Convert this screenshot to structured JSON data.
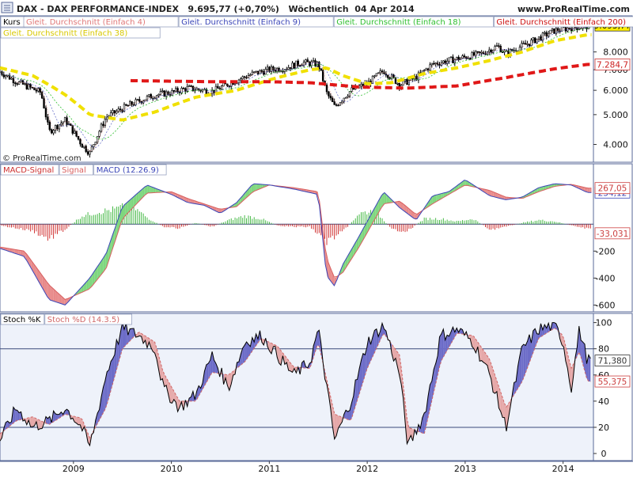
{
  "header": {
    "instrument": "DAX - DAX PERFORMANCE-INDEX",
    "last_change": "9.695,77 (+0,70%)",
    "period": "Wöchentlich",
    "date": "04 Apr 2014",
    "website": "www.ProRealTime.com",
    "watermark": "© ProRealTime.com"
  },
  "colors": {
    "ma4": "#e07878",
    "ma9": "#3b46b8",
    "ma18": "#2fbf2f",
    "ma200": "#e01818",
    "ma38": "#f0e000",
    "macd_line": "#3b46b8",
    "macd_signal": "#d86060",
    "macd_hist_pos": "#34b234",
    "macd_hist_neg": "#cc2020",
    "stoch_k": "#000000",
    "stoch_d": "#d06868",
    "stoch_fill_up": "#6c6cc8",
    "stoch_fill_down": "#e6a8a8",
    "frame": "#5a6a98",
    "panel_bg": "#eef2fa"
  },
  "chart_data": [
    {
      "type": "line",
      "name": "price-panel",
      "legend": {
        "title": "Kurs",
        "items": [
          "Gleit. Durchschnitt (Einfach 4)",
          "Gleit. Durchschnitt (Einfach 9)",
          "Gleit. Durchschnitt (Einfach 18)",
          "Gleit. Durchschnitt (Einfach 200)",
          "Gleit. Durchschnitt (Einfach 38)"
        ]
      },
      "x_labels": [
        "2009",
        "2010",
        "2011",
        "2012",
        "2013",
        "2014"
      ],
      "y_ticks": [
        4000,
        5000,
        6000,
        7000,
        8000
      ],
      "y_tick_labels": [
        "4.000",
        "5.000",
        "6.000",
        "7.000",
        "8.000"
      ],
      "ylim": [
        3500,
        10000
      ],
      "y_log": true,
      "price_path": {
        "x": [
          "2008-04",
          "2008-06",
          "2008-09",
          "2008-10",
          "2008-12",
          "2009-02",
          "2009-03",
          "2009-05",
          "2009-08",
          "2009-11",
          "2010-01",
          "2010-03",
          "2010-06",
          "2010-08",
          "2010-11",
          "2011-01",
          "2011-03",
          "2011-05",
          "2011-07",
          "2011-08",
          "2011-09",
          "2011-11",
          "2012-01",
          "2012-03",
          "2012-05",
          "2012-07",
          "2012-09",
          "2012-12",
          "2013-03",
          "2013-05",
          "2013-06",
          "2013-09",
          "2013-12",
          "2014-02",
          "2014-04"
        ],
        "values": [
          6900,
          6400,
          5900,
          4400,
          4800,
          4000,
          3750,
          4900,
          5400,
          5800,
          5900,
          6100,
          5950,
          6300,
          6800,
          7000,
          7100,
          7400,
          7300,
          5900,
          5300,
          6000,
          6300,
          6950,
          6250,
          6600,
          7300,
          7600,
          7900,
          8350,
          7900,
          8600,
          9400,
          9600,
          9696
        ]
      },
      "ma38_path": {
        "x": [
          "2008-04",
          "2008-08",
          "2008-12",
          "2009-03",
          "2009-07",
          "2009-11",
          "2010-04",
          "2010-09",
          "2011-02",
          "2011-06",
          "2011-08",
          "2011-10",
          "2012-01",
          "2012-04",
          "2012-08",
          "2012-12",
          "2013-04",
          "2013-08",
          "2013-12",
          "2014-04"
        ],
        "values": [
          7100,
          6700,
          5800,
          5000,
          4800,
          5100,
          5700,
          6000,
          6600,
          7000,
          7100,
          6700,
          6300,
          6350,
          6800,
          7100,
          7500,
          8000,
          8700,
          9100
        ]
      },
      "ma200_path": {
        "x": [
          "2009-08",
          "2010-06",
          "2011-01",
          "2011-06",
          "2011-12",
          "2012-06",
          "2012-12",
          "2013-06",
          "2013-12",
          "2014-04"
        ],
        "values": [
          6450,
          6400,
          6400,
          6350,
          6150,
          6100,
          6200,
          6600,
          7050,
          7285
        ]
      },
      "value_labels": [
        "9.695,77",
        "7.284,7"
      ]
    },
    {
      "type": "line",
      "name": "macd-panel",
      "legend": {
        "items": [
          "MACD-Signal",
          "Signal",
          "MACD (12.26.9)"
        ]
      },
      "y_ticks": [
        -600,
        -400,
        -200
      ],
      "y_tick_labels": [
        "-600",
        "-400",
        "-200"
      ],
      "ylim": [
        -650,
        400
      ],
      "series": [
        {
          "name": "MACD (12.26.9)",
          "x": [
            "2008-04",
            "2008-07",
            "2008-10",
            "2008-12",
            "2009-03",
            "2009-05",
            "2009-07",
            "2009-10",
            "2010-01",
            "2010-03",
            "2010-05",
            "2010-07",
            "2010-09",
            "2010-11",
            "2011-01",
            "2011-04",
            "2011-07",
            "2011-08",
            "2011-09",
            "2011-10",
            "2011-12",
            "2012-03",
            "2012-05",
            "2012-07",
            "2012-09",
            "2012-11",
            "2013-01",
            "2013-04",
            "2013-06",
            "2013-08",
            "2013-10",
            "2013-12",
            "2014-02",
            "2014-04"
          ],
          "values": [
            -180,
            -240,
            -560,
            -600,
            -400,
            -220,
            130,
            290,
            220,
            160,
            140,
            80,
            160,
            300,
            290,
            260,
            220,
            -380,
            -460,
            -300,
            -90,
            240,
            120,
            30,
            210,
            240,
            330,
            210,
            180,
            200,
            270,
            300,
            290,
            234
          ]
        },
        {
          "name": "Signal",
          "x": [
            "2008-04",
            "2008-07",
            "2008-10",
            "2008-12",
            "2009-03",
            "2009-05",
            "2009-07",
            "2009-10",
            "2010-01",
            "2010-03",
            "2010-05",
            "2010-07",
            "2010-09",
            "2010-11",
            "2011-01",
            "2011-04",
            "2011-07",
            "2011-08",
            "2011-09",
            "2011-10",
            "2011-12",
            "2012-03",
            "2012-05",
            "2012-07",
            "2012-09",
            "2012-11",
            "2013-01",
            "2013-04",
            "2013-06",
            "2013-08",
            "2013-10",
            "2013-12",
            "2014-02",
            "2014-04"
          ],
          "values": [
            -170,
            -200,
            -450,
            -560,
            -480,
            -330,
            40,
            230,
            240,
            190,
            150,
            110,
            130,
            240,
            290,
            270,
            240,
            -250,
            -400,
            -360,
            -170,
            150,
            170,
            70,
            150,
            220,
            290,
            250,
            200,
            190,
            240,
            280,
            295,
            267
          ]
        },
        {
          "name": "MACD-Signal",
          "x": [
            "2008-04",
            "2008-06",
            "2008-08",
            "2008-10",
            "2008-12",
            "2009-02",
            "2009-04",
            "2009-06",
            "2009-08",
            "2009-10",
            "2009-12",
            "2010-02",
            "2010-04",
            "2010-06",
            "2010-08",
            "2010-10",
            "2010-12",
            "2011-02",
            "2011-04",
            "2011-06",
            "2011-08",
            "2011-10",
            "2011-12",
            "2012-02",
            "2012-04",
            "2012-06",
            "2012-08",
            "2012-10",
            "2012-12",
            "2013-02",
            "2013-04",
            "2013-06",
            "2013-08",
            "2013-10",
            "2013-12",
            "2014-02",
            "2014-04"
          ],
          "values": [
            -10,
            -30,
            -50,
            -110,
            -40,
            60,
            90,
            110,
            140,
            50,
            -20,
            -30,
            10,
            -20,
            30,
            60,
            40,
            -10,
            -20,
            -20,
            -130,
            -60,
            80,
            100,
            -40,
            -50,
            40,
            40,
            20,
            40,
            -40,
            -20,
            10,
            30,
            20,
            -10,
            -33
          ]
        }
      ],
      "value_labels": [
        "234,12",
        "267,05",
        "-33,031"
      ]
    },
    {
      "type": "line",
      "name": "stoch-panel",
      "legend": {
        "items": [
          "Stoch %K",
          "Stoch %D (14.3.5)"
        ]
      },
      "y_ticks": [
        0,
        20,
        40,
        60,
        80,
        100
      ],
      "y_tick_labels": [
        "0",
        "20",
        "40",
        "60",
        "80",
        "100"
      ],
      "ylim": [
        -3,
        104
      ],
      "levels": [
        20,
        80
      ],
      "series": [
        {
          "name": "Stoch %K",
          "x": [
            "2008-04",
            "2008-06",
            "2008-08",
            "2008-10",
            "2008-12",
            "2009-02",
            "2009-03",
            "2009-05",
            "2009-07",
            "2009-09",
            "2009-11",
            "2009-12",
            "2010-02",
            "2010-04",
            "2010-06",
            "2010-08",
            "2010-10",
            "2010-12",
            "2011-02",
            "2011-04",
            "2011-06",
            "2011-07",
            "2011-09",
            "2011-11",
            "2012-01",
            "2012-03",
            "2012-05",
            "2012-06",
            "2012-08",
            "2012-10",
            "2012-12",
            "2013-02",
            "2013-04",
            "2013-06",
            "2013-08",
            "2013-10",
            "2013-12",
            "2014-01",
            "2014-02",
            "2014-03",
            "2014-04"
          ],
          "values": [
            10,
            35,
            20,
            25,
            35,
            20,
            5,
            60,
            96,
            90,
            80,
            50,
            35,
            45,
            75,
            50,
            85,
            90,
            75,
            60,
            70,
            95,
            10,
            40,
            85,
            98,
            60,
            5,
            30,
            90,
            95,
            85,
            60,
            20,
            80,
            95,
            98,
            85,
            50,
            95,
            71
          ]
        },
        {
          "name": "Stoch %D (14.3.5)",
          "x": [
            "2008-04",
            "2008-06",
            "2008-08",
            "2008-10",
            "2008-12",
            "2009-02",
            "2009-03",
            "2009-05",
            "2009-07",
            "2009-09",
            "2009-11",
            "2009-12",
            "2010-02",
            "2010-04",
            "2010-06",
            "2010-08",
            "2010-10",
            "2010-12",
            "2011-02",
            "2011-04",
            "2011-06",
            "2011-07",
            "2011-09",
            "2011-11",
            "2012-01",
            "2012-03",
            "2012-05",
            "2012-06",
            "2012-08",
            "2012-10",
            "2012-12",
            "2013-02",
            "2013-04",
            "2013-06",
            "2013-08",
            "2013-10",
            "2013-12",
            "2014-01",
            "2014-02",
            "2014-03",
            "2014-04"
          ],
          "values": [
            15,
            25,
            28,
            22,
            30,
            27,
            12,
            35,
            80,
            93,
            85,
            62,
            40,
            40,
            62,
            60,
            70,
            88,
            82,
            66,
            65,
            85,
            30,
            25,
            65,
            92,
            75,
            20,
            15,
            70,
            92,
            90,
            72,
            35,
            55,
            88,
            96,
            90,
            65,
            78,
            55
          ]
        }
      ],
      "value_labels": [
        "71,380",
        "55,375"
      ]
    }
  ]
}
